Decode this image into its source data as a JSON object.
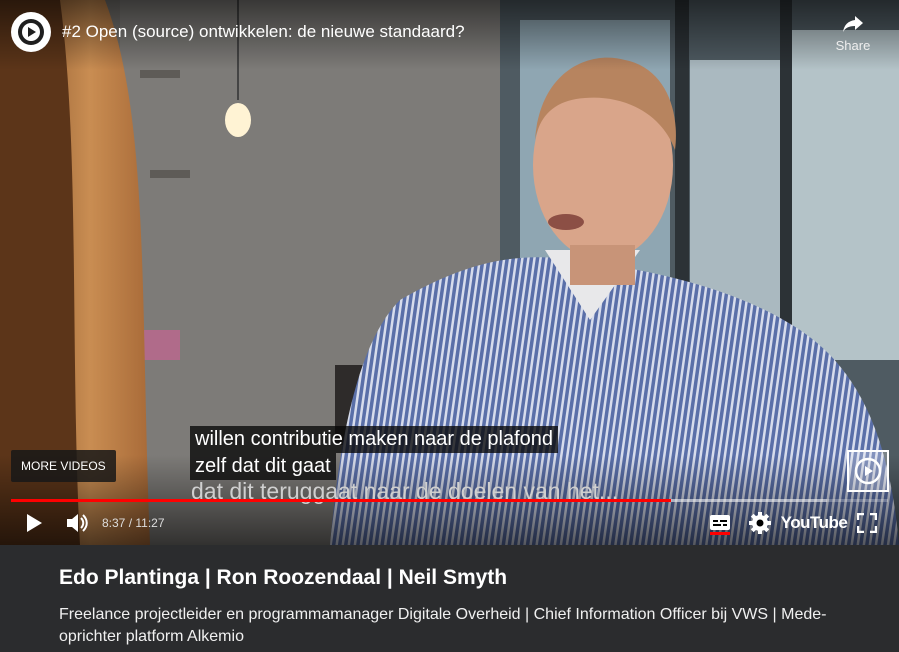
{
  "player": {
    "title": "#2 Open (source) ontwikkelen: de nieuwe standaard?",
    "share_label": "Share",
    "more_videos_label": "MORE VIDEOS",
    "captions": [
      "willen contributie maken naar de plafond",
      "zelf dat dit gaat",
      "dat dit teruggaat naar de doelen van het..."
    ],
    "time_current": "8:37",
    "time_separator": " / ",
    "time_total": "11:27",
    "progress_played_fraction": 0.753,
    "progress_loaded_fraction": 0.93,
    "brand_label": "YouTube",
    "accent_color": "#ff0000"
  },
  "info": {
    "title": "Edo Plantinga | Ron Roozendaal | Neil Smyth",
    "description": "Freelance projectleider en programmamanager Digitale Overheid | Chief Information Officer bij VWS | Mede-oprichter platform Alkemio"
  },
  "icons": [
    "play-icon",
    "volume-icon",
    "subtitles-icon",
    "settings-icon",
    "fullscreen-icon",
    "share-icon",
    "channel-logo-icon"
  ]
}
